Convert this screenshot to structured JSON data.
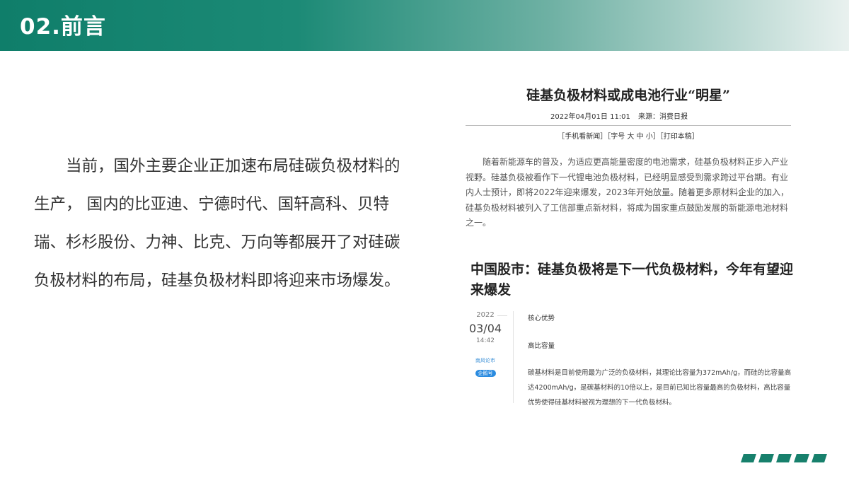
{
  "header": {
    "title": "02.前言"
  },
  "intro": {
    "text": "当前，国外主要企业正加速布局硅碳负极材料的生产， 国内的比亚迪、宁德时代、国轩高科、贝特瑞、杉杉股份、力神、比克、万向等都展开了对硅碳负极材料的布局，硅基负极材料即将迎来市场爆发。"
  },
  "article1": {
    "title": "硅基负极材料或成电池行业“明星”",
    "date": "2022年04月01日  11:01",
    "source": "来源：消费日报",
    "links": "［手机看新闻］［字号 大 中 小］［打印本稿］",
    "body": "随着新能源车的普及，为适应更高能量密度的电池需求，硅基负极材料正步入产业视野。硅基负极被看作下一代锂电池负极材料，已经明显感受到需求跨过平台期。有业内人士预计，即将2022年迎来爆发，2023年开始放量。随着更多原材料企业的加入，硅基负极材料被列入了工信部重点新材料，将成为国家重点鼓励发展的新能源电池材料之一。"
  },
  "article2": {
    "title": "中国股市：硅基负极将是下一代负极材料，今年有望迎来爆发",
    "year": "2022",
    "day": "03/04",
    "time": "14:42",
    "source_name": "南风论市",
    "badge": "企鹅号",
    "section1": "核心优势",
    "section2": "高比容量",
    "body": "碳基材料是目前使用最为广泛的负极材料，其理论比容量为372mAh/g，而硅的比容量高达4200mAh/g，是碳基材料的10倍以上，是目前已知比容量最高的负极材料，高比容量优势使得硅基材料被视为理想的下一代负极材料。"
  },
  "colors": {
    "brand": "#17806c",
    "header_start": "#0f7e6a",
    "header_end": "#e9f1ef"
  }
}
